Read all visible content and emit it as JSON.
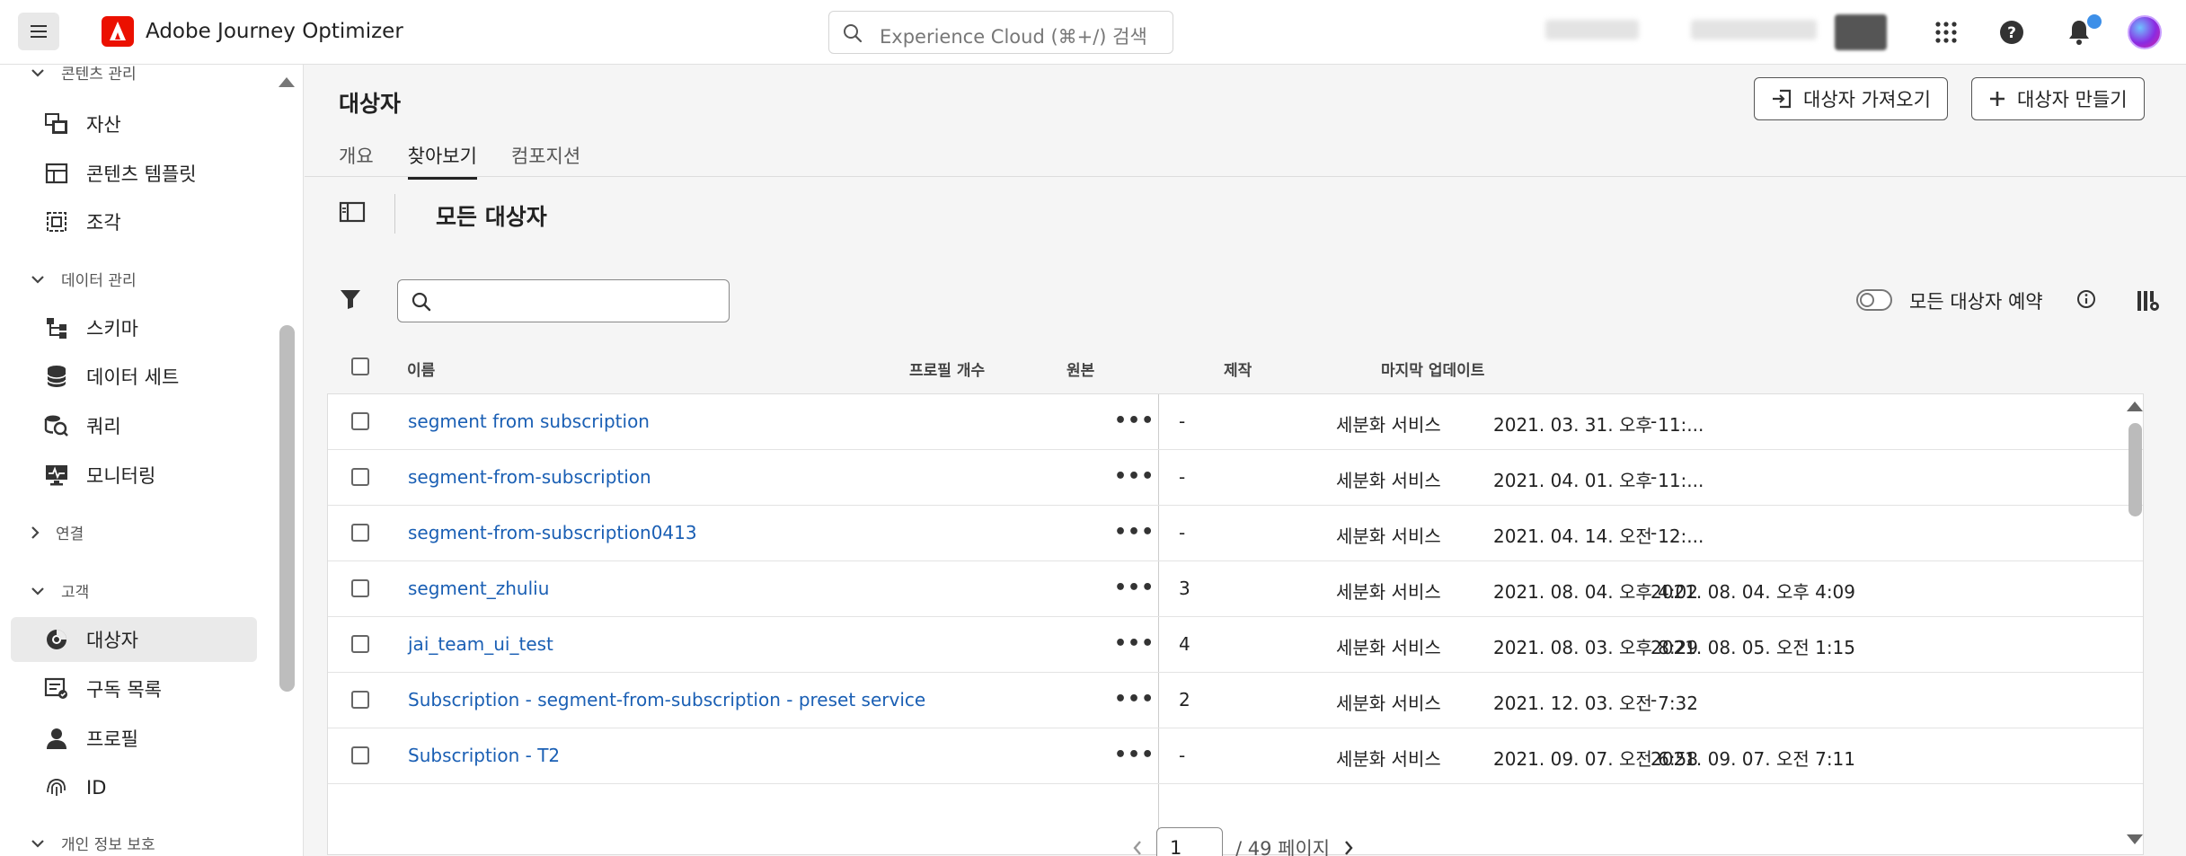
{
  "app": {
    "title": "Adobe Journey Optimizer"
  },
  "search": {
    "placeholder": "Experience Cloud (⌘+/) 검색"
  },
  "colors": {
    "link": "#1a5fb4",
    "adobe_red": "#eb1000",
    "notification": "#3d8fe8"
  },
  "sidebar": {
    "sections": [
      {
        "label": "콘텐츠 관리",
        "expanded": true
      },
      {
        "label": "데이터 관리",
        "expanded": true
      },
      {
        "label": "연결",
        "expanded": false
      },
      {
        "label": "고객",
        "expanded": true
      },
      {
        "label": "개인 정보 보호",
        "expanded": true
      }
    ],
    "items": [
      {
        "label": "자산",
        "icon": "assets-icon"
      },
      {
        "label": "콘텐츠 템플릿",
        "icon": "content-template-icon"
      },
      {
        "label": "조각",
        "icon": "fragment-icon"
      },
      {
        "label": "스키마",
        "icon": "schema-icon"
      },
      {
        "label": "데이터 세트",
        "icon": "dataset-icon"
      },
      {
        "label": "쿼리",
        "icon": "query-icon"
      },
      {
        "label": "모니터링",
        "icon": "monitoring-icon"
      },
      {
        "label": "대상자",
        "icon": "audience-icon",
        "active": true
      },
      {
        "label": "구독 목록",
        "icon": "subscription-list-icon"
      },
      {
        "label": "프로필",
        "icon": "profile-icon"
      },
      {
        "label": "ID",
        "icon": "fingerprint-icon"
      }
    ]
  },
  "page": {
    "title": "대상자",
    "import_button": "대상자 가져오기",
    "create_button": "대상자 만들기",
    "tabs": [
      {
        "label": "개요",
        "active": false
      },
      {
        "label": "찾아보기",
        "active": true
      },
      {
        "label": "컴포지션",
        "active": false
      }
    ],
    "section_title": "모든 대상자",
    "toggle_label": "모든 대상자 예약",
    "toggle_on": false
  },
  "table": {
    "columns": [
      "이름",
      "프로필 개수",
      "원본",
      "제작",
      "마지막 업데이트"
    ],
    "rows": [
      {
        "name": "segment from subscription",
        "profiles": "-",
        "origin": "세분화 서비스",
        "created": "2021. 03. 31. 오후 11:...",
        "updated": "-"
      },
      {
        "name": "segment-from-subscription",
        "profiles": "-",
        "origin": "세분화 서비스",
        "created": "2021. 04. 01. 오후 11:...",
        "updated": "-"
      },
      {
        "name": "segment-from-subscription0413",
        "profiles": "-",
        "origin": "세분화 서비스",
        "created": "2021. 04. 14. 오전 12:...",
        "updated": "-"
      },
      {
        "name": "segment_zhuliu",
        "profiles": "3",
        "origin": "세분화 서비스",
        "created": "2021. 08. 04. 오후 4:02",
        "updated": "2021. 08. 04. 오후 4:09"
      },
      {
        "name": "jai_team_ui_test",
        "profiles": "4",
        "origin": "세분화 서비스",
        "created": "2021. 08. 03. 오후 8:29",
        "updated": "2021. 08. 05. 오전 1:15"
      },
      {
        "name": "Subscription - segment-from-subscription - preset service",
        "profiles": "2",
        "origin": "세분화 서비스",
        "created": "2021. 12. 03. 오전 7:32",
        "updated": "-"
      },
      {
        "name": "Subscription - T2",
        "profiles": "-",
        "origin": "세분화 서비스",
        "created": "2021. 09. 07. 오전 6:58",
        "updated": "2021. 09. 07. 오전 7:11"
      }
    ]
  },
  "pagination": {
    "current": "1",
    "total_label": "/ 49 페이지"
  }
}
